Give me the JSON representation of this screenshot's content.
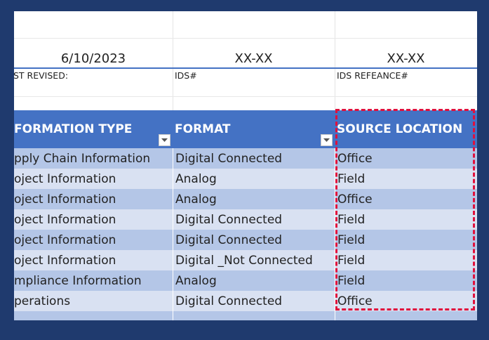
{
  "meta": {
    "date_value": "6/10/2023",
    "ids_value": "XX-XX",
    "ids_ref_value": "XX-XX",
    "last_revised_label": "ST REVISED:",
    "ids_label": "IDS#",
    "ids_ref_label": "IDS REFEANCE#"
  },
  "table": {
    "headers": [
      "FORMATION TYPE",
      "FORMAT",
      "SOURCE LOCATION"
    ],
    "rows": [
      [
        "pply Chain Information",
        "Digital Connected",
        "Office"
      ],
      [
        "oject Information",
        "Analog",
        "Field"
      ],
      [
        "oject Information",
        "Analog",
        "Office"
      ],
      [
        "oject Information",
        "Digital Connected",
        "Field"
      ],
      [
        "oject Information",
        "Digital Connected",
        "Field"
      ],
      [
        "oject Information",
        "Digital _Not Connected",
        "Field"
      ],
      [
        "mpliance Information",
        "Analog",
        "Field"
      ],
      [
        "perations",
        "Digital Connected",
        "Office"
      ]
    ]
  },
  "colors": {
    "frame": "#1f3a6e",
    "header_bg": "#4472c4",
    "band_dark": "#b4c6e7",
    "band_light": "#d9e1f2",
    "highlight": "#e0103c"
  },
  "icons": {
    "filter": "dropdown-arrow-icon"
  }
}
